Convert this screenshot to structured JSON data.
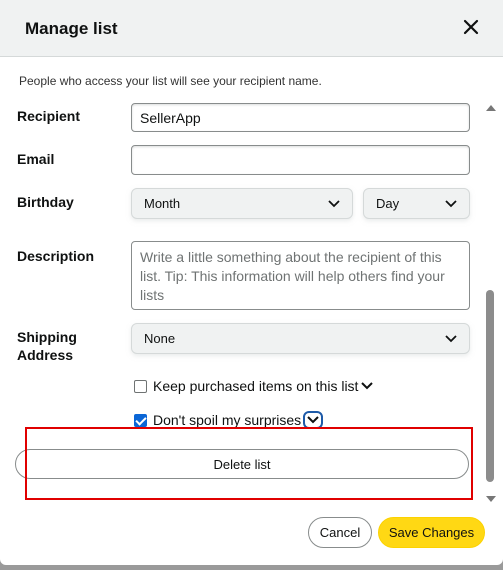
{
  "dialog": {
    "title": "Manage list",
    "note": "People who access your list will see your recipient name."
  },
  "form": {
    "recipient_label": "Recipient",
    "recipient_value": "SellerApp",
    "email_label": "Email",
    "email_value": "",
    "birthday_label": "Birthday",
    "month_value": "Month",
    "day_value": "Day",
    "description_label": "Description",
    "description_placeholder": "Write a little something about the recipient of this list. Tip: This information will help others find your lists",
    "shipping_label_line1": "Shipping",
    "shipping_label_line2": "Address",
    "shipping_value": "None",
    "keep_purchased_label": "Keep purchased items on this list",
    "keep_purchased_checked": false,
    "dont_spoil_label": "Don't spoil my surprises",
    "dont_spoil_checked": true
  },
  "actions": {
    "delete_label": "Delete list",
    "cancel_label": "Cancel",
    "save_label": "Save Changes"
  },
  "colors": {
    "save_button": "#ffd814",
    "highlight_box": "#e00000",
    "focus_ring": "#1d5aa8",
    "checkbox_checked": "#0b66d6"
  }
}
